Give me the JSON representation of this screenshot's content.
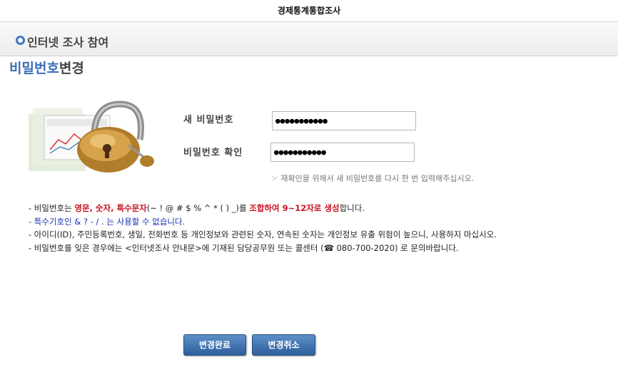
{
  "header": {
    "title": "경제통계통합조사"
  },
  "section": {
    "label": "인터넷 조사 참여"
  },
  "page_title": {
    "part1": "비밀번호",
    "part2": "변경"
  },
  "form": {
    "new_password_label": "새 비밀번호",
    "new_password_value": "●●●●●●●●●●●",
    "confirm_label": "비밀번호 확인",
    "confirm_value": "●●●●●●●●●●●",
    "hint_icon": "☞",
    "hint": "재확인을 위해서 새 비밀번호를 다시 한 번 입력해주십시오."
  },
  "notes": {
    "l1_a": "- 비밀번호는 ",
    "l1_b": "영문, 숫자, 특수문자",
    "l1_c": "(~ ! @ # $ % ^ * ( ) _)를 ",
    "l1_d": "조합하여 9~12자로 생성",
    "l1_e": "합니다.",
    "l2": "- 특수기호인 & ? - / . 는 사용할 수 없습니다.",
    "l3": "- 아이디(ID), 주민등록번호, 생일, 전화번호 등 개인정보와 관련된 숫자, 연속된 숫자는 개인정보 유출 위험이 높으니, 사용하지 마십시오.",
    "l4": "- 비밀번호를 잊은 경우에는 <인터넷조사 안내문>에 기재된 담당공무원 또는 콜센터 (☎ 080-700-2020) 로 문의바랍니다."
  },
  "buttons": {
    "confirm": "변경완료",
    "cancel": "변경취소"
  },
  "colors": {
    "accent": "#3b6fb6",
    "button": "#3a6fae",
    "warning": "#cc1122",
    "note_blue": "#1a2fb0"
  },
  "icons": {
    "bullet": "circle-bullet-icon",
    "lock": "padlock-illustration"
  }
}
